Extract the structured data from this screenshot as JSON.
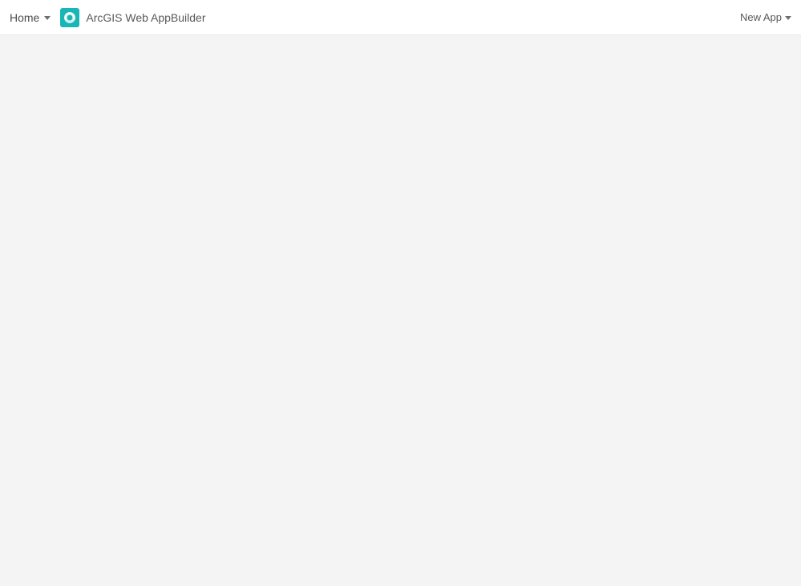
{
  "header": {
    "home_label": "Home",
    "app_title": "ArcGIS Web AppBuilder",
    "new_app_label": "New App"
  }
}
